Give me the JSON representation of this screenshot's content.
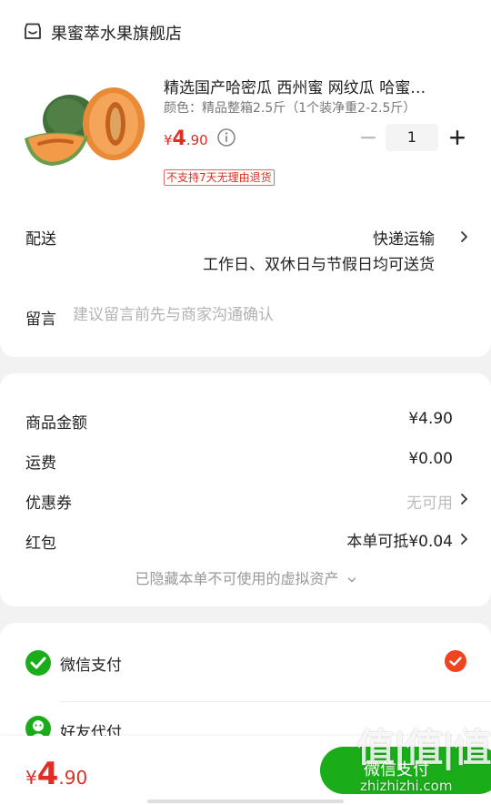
{
  "store": {
    "name": "果蜜萃水果旗舰店",
    "icon": "store-icon"
  },
  "product": {
    "title": "精选国产哈密瓜 西州蜜 网纹瓜 哈蜜…",
    "spec": "颜色：精品整箱2.5斤（1个装净重2-2.5斤）",
    "price_symbol": "¥",
    "price_int": "4",
    "price_dec": ".90",
    "quantity": "1",
    "tag": "不支持7天无理由退货"
  },
  "shipping": {
    "label": "配送",
    "value": "快递运输",
    "sub": "工作日、双休日与节假日均可送货"
  },
  "message": {
    "label": "留言",
    "placeholder": "建议留言前先与商家沟通确认"
  },
  "summary": {
    "goods_label": "商品金额",
    "goods_value": "¥4.90",
    "freight_label": "运费",
    "freight_value": "¥0.00",
    "coupon_label": "优惠券",
    "coupon_value": "无可用",
    "redpacket_label": "红包",
    "redpacket_value": "本单可抵¥0.04",
    "hidden_assets": "已隐藏本单不可使用的虚拟资产"
  },
  "payment": {
    "wechat_label": "微信支付",
    "friend_label": "好友代付"
  },
  "bottom": {
    "total_symbol": "¥",
    "total_int": "4",
    "total_dec": ".90",
    "pay_button": "微信支付"
  },
  "watermark": {
    "title": "值|值|值",
    "url": "zhizhizhi.com"
  },
  "colors": {
    "accent_red": "#e02e24",
    "wechat_green": "#1aad19",
    "check_orange": "#f0441f"
  }
}
